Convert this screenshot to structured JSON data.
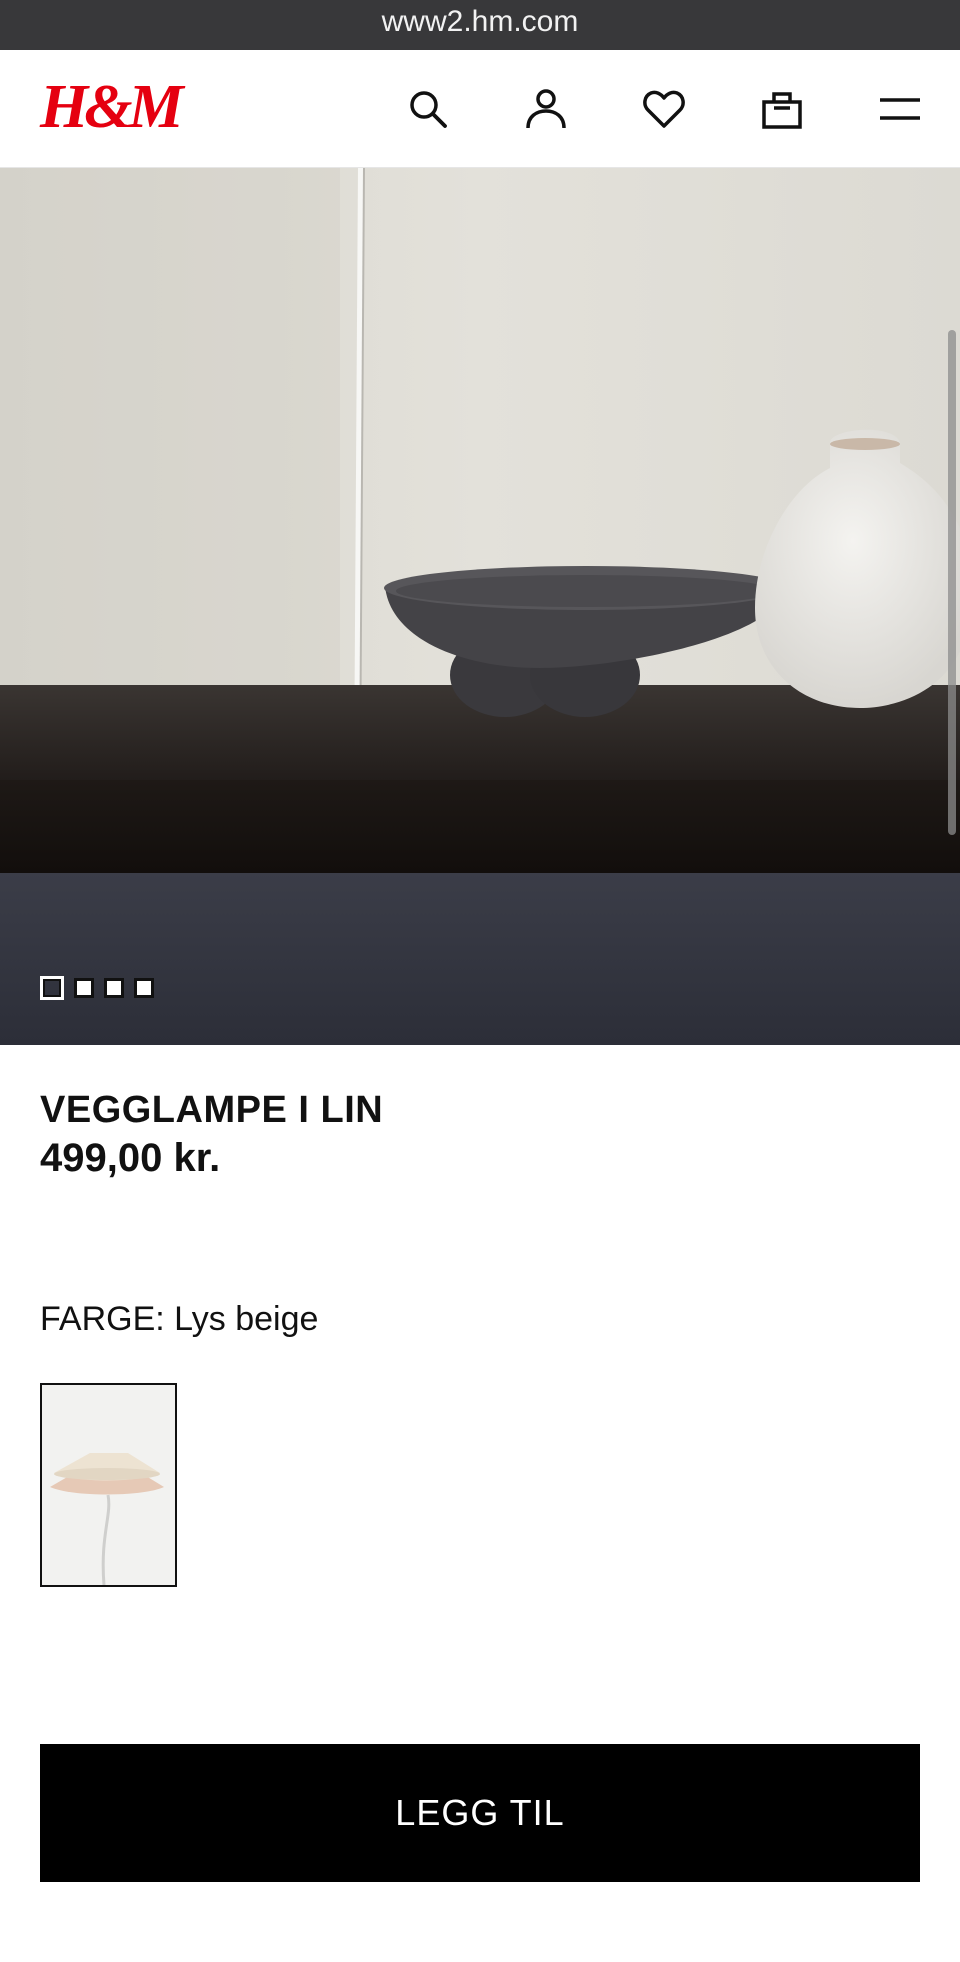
{
  "browser": {
    "url": "www2.hm.com"
  },
  "header": {
    "logo_text": "H&M",
    "brand_color": "#e50010",
    "icons": [
      "search-icon",
      "account-icon",
      "favorites-icon",
      "bag-icon",
      "menu-icon"
    ]
  },
  "gallery": {
    "image_count": 4,
    "active_index": 0
  },
  "product": {
    "name": "VEGGLAMPE I LIN",
    "price": "499,00 kr.",
    "color_label": "FARGE: Lys beige"
  },
  "actions": {
    "add_label": "LEGG TIL"
  },
  "colors": {
    "button_bg": "#000000",
    "button_text": "#ffffff"
  }
}
